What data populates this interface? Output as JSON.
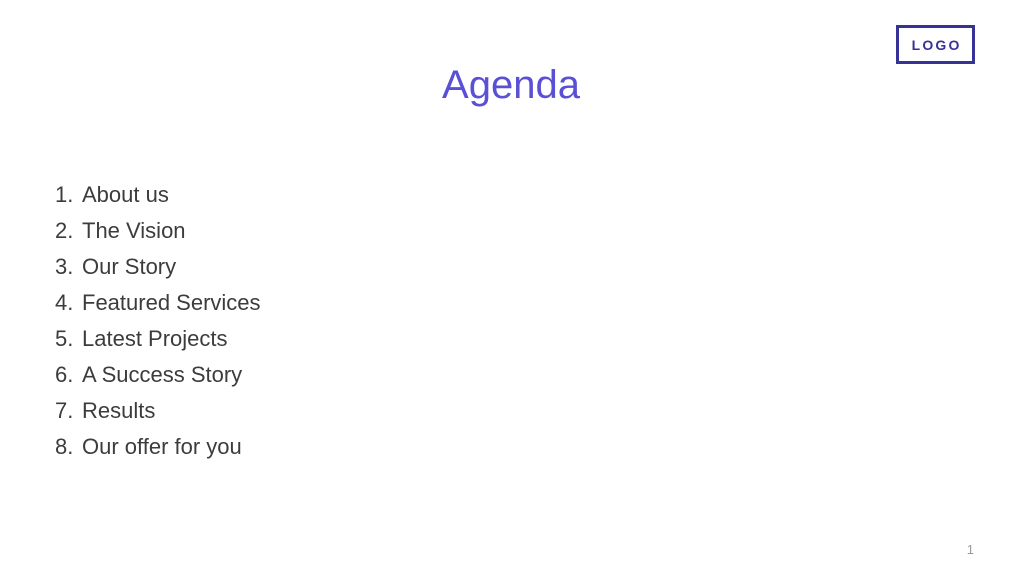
{
  "slide": {
    "title": "Agenda",
    "title_color": "#5b4fd6",
    "background_color": "#ffffff",
    "page_number": "1"
  },
  "logo": {
    "text": "LOGO",
    "color": "#373296",
    "border_color": "#373296"
  },
  "agenda": {
    "items": [
      {
        "number": "1.",
        "label": "About us"
      },
      {
        "number": "2.",
        "label": "The Vision"
      },
      {
        "number": "3.",
        "label": "Our Story"
      },
      {
        "number": "4.",
        "label": "Featured Services"
      },
      {
        "number": "5.",
        "label": "Latest Projects"
      },
      {
        "number": "6.",
        "label": "A Success Story"
      },
      {
        "number": "7.",
        "label": "Results"
      },
      {
        "number": "8.",
        "label": "Our offer for you"
      }
    ],
    "text_color": "#3c3c3c"
  }
}
